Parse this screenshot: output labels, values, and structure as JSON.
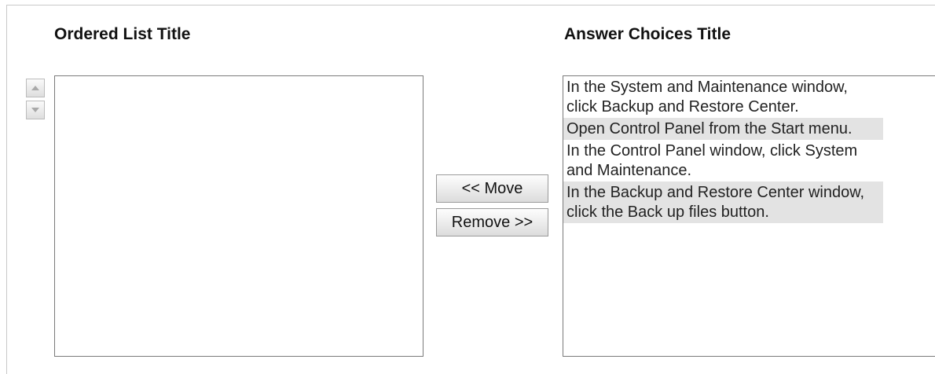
{
  "ordered_list": {
    "title": "Ordered List Title",
    "items": []
  },
  "answer_choices": {
    "title": "Answer Choices Title",
    "items": [
      "In the System and Maintenance window, click Backup and Restore Center.",
      "Open Control Panel from the Start menu.",
      "In the Control Panel window, click System and Maintenance.",
      "In the Backup and Restore Center window, click the Back up files button."
    ]
  },
  "buttons": {
    "move_label": "<< Move",
    "remove_label": "Remove >>"
  },
  "icons": {
    "up": "triangle-up-icon",
    "down": "triangle-down-icon"
  }
}
